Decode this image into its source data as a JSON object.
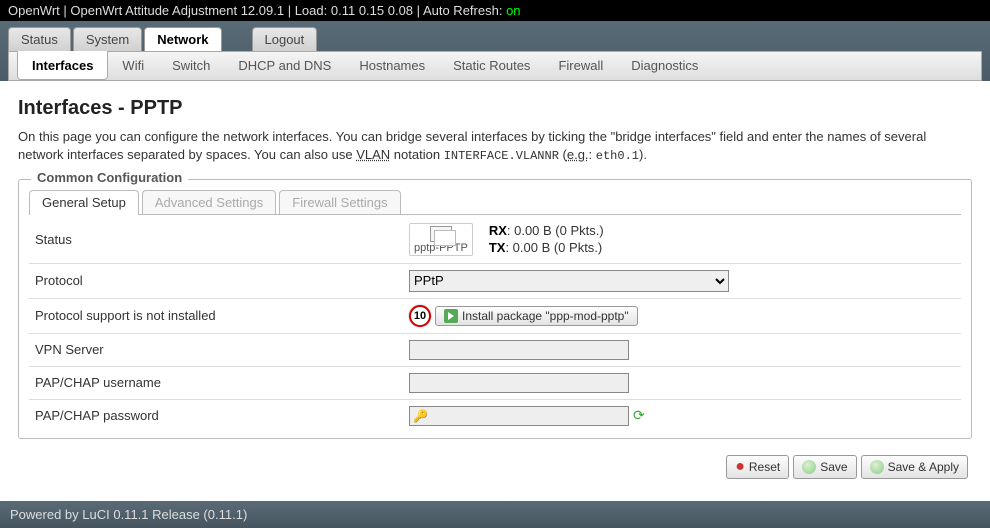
{
  "topbar": {
    "hostname": "OpenWrt",
    "firmware": "OpenWrt Attitude Adjustment 12.09.1",
    "load_label": "Load:",
    "load": "0.11 0.15 0.08",
    "autorefresh_label": "Auto Refresh:",
    "autorefresh_state": "on"
  },
  "nav": {
    "tabs": [
      {
        "label": "Status"
      },
      {
        "label": "System"
      },
      {
        "label": "Network",
        "active": true
      },
      {
        "label": "Logout"
      }
    ],
    "subtabs": [
      {
        "label": "Interfaces",
        "active": true
      },
      {
        "label": "Wifi"
      },
      {
        "label": "Switch"
      },
      {
        "label": "DHCP and DNS"
      },
      {
        "label": "Hostnames"
      },
      {
        "label": "Static Routes"
      },
      {
        "label": "Firewall"
      },
      {
        "label": "Diagnostics"
      }
    ]
  },
  "page": {
    "title": "Interfaces - PPTP",
    "desc_a": "On this page you can configure the network interfaces. You can bridge several interfaces by ticking the \"bridge interfaces\" field and enter the names of several network interfaces separated by spaces. You can also use ",
    "desc_vlan": "VLAN",
    "desc_b": " notation ",
    "desc_notation": "INTERFACE.VLANNR",
    "desc_c": " (",
    "desc_eg": "e.g.",
    "desc_d": ": ",
    "desc_example": "eth0.1",
    "desc_e": ")."
  },
  "fieldset": {
    "legend": "Common Configuration",
    "tabs": [
      {
        "label": "General Setup",
        "active": true
      },
      {
        "label": "Advanced Settings"
      },
      {
        "label": "Firewall Settings"
      }
    ],
    "status": {
      "label": "Status",
      "iface": "pptp-PPTP",
      "rx_label": "RX",
      "rx_value": ": 0.00 B (0 Pkts.)",
      "tx_label": "TX",
      "tx_value": ": 0.00 B (0 Pkts.)"
    },
    "protocol": {
      "label": "Protocol",
      "value": "PPtP"
    },
    "notinstalled": {
      "label": "Protocol support is not installed",
      "badge": "10",
      "button": "Install package \"ppp-mod-pptp\""
    },
    "vpn": {
      "label": "VPN Server",
      "value": ""
    },
    "user": {
      "label": "PAP/CHAP username",
      "value": ""
    },
    "pass": {
      "label": "PAP/CHAP password",
      "value": ""
    }
  },
  "buttons": {
    "reset": "Reset",
    "save": "Save",
    "save_apply": "Save & Apply"
  },
  "footer": "Powered by LuCI 0.11.1 Release (0.11.1)"
}
